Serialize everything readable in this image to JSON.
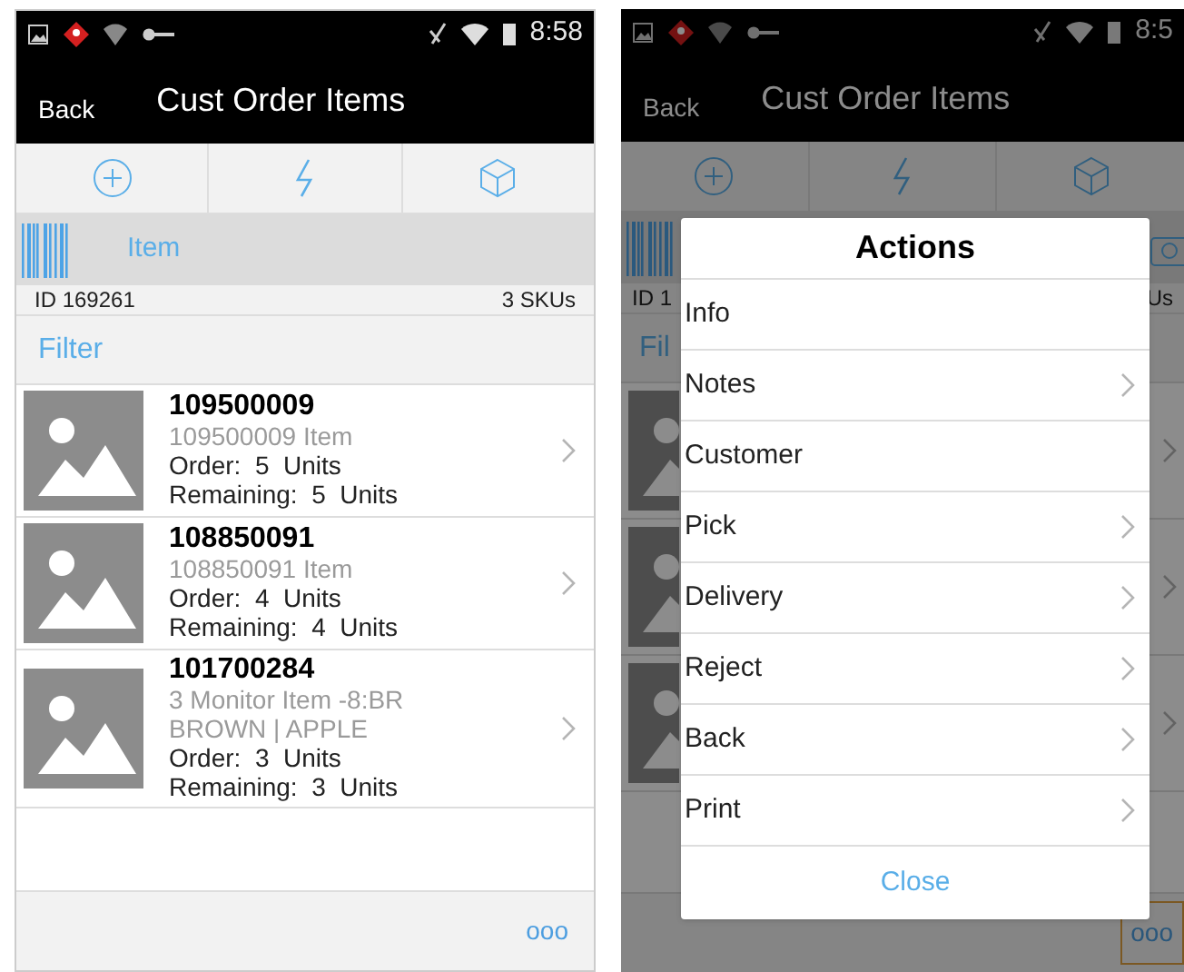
{
  "left_screen": {
    "status_time": "8:58",
    "header": {
      "back": "Back",
      "title": "Cust Order Items"
    },
    "scan": {
      "label": "Item"
    },
    "summary": {
      "id": "ID 169261",
      "count": "3 SKUs"
    },
    "filter": "Filter",
    "items": [
      {
        "number": "109500009",
        "description": [
          "109500009 Item"
        ],
        "order": "Order:  5  Units",
        "remaining": "Remaining:  5  Units"
      },
      {
        "number": "108850091",
        "description": [
          "108850091 Item"
        ],
        "order": "Order:  4  Units",
        "remaining": "Remaining:  4  Units"
      },
      {
        "number": "101700284",
        "description": [
          "3 Monitor Item -8:BR",
          "BROWN | APPLE"
        ],
        "order": "Order:  3  Units",
        "remaining": "Remaining:  3  Units"
      }
    ],
    "footer_more": "ooo"
  },
  "right_screen": {
    "status_time": "8:5",
    "header": {
      "back": "Back",
      "title": "Cust Order Items"
    },
    "summary": {
      "id": "ID 1",
      "count": "Us"
    },
    "filter": "Fil",
    "footer_more": "ooo",
    "dialog": {
      "title": "Actions",
      "actions": [
        {
          "label": "Info",
          "has_submenu": false
        },
        {
          "label": "Notes",
          "has_submenu": true
        },
        {
          "label": "Customer",
          "has_submenu": false
        },
        {
          "label": "Pick",
          "has_submenu": true
        },
        {
          "label": "Delivery",
          "has_submenu": true
        },
        {
          "label": "Reject",
          "has_submenu": true
        },
        {
          "label": "Back",
          "has_submenu": true
        },
        {
          "label": "Print",
          "has_submenu": true
        }
      ],
      "close": "Close"
    }
  }
}
